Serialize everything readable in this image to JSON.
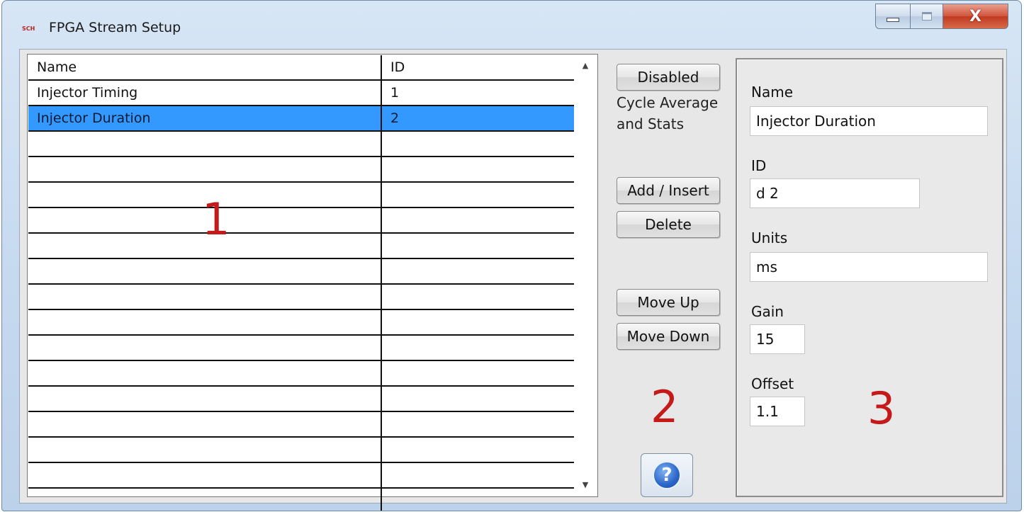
{
  "window": {
    "title": "FPGA Stream Setup",
    "icon_text": "SCH",
    "controls": {
      "close_glyph": "X"
    }
  },
  "table": {
    "columns": [
      "Name",
      "ID"
    ],
    "rows": [
      {
        "name": "Injector Timing",
        "id": "1"
      },
      {
        "name": "Injector Duration",
        "id": "2",
        "selected": true
      }
    ],
    "selected_color": "#3399ff"
  },
  "buttons": {
    "disabled": "Disabled",
    "cycle_label": "Cycle Average and Stats",
    "add_insert": "Add / Insert",
    "delete": "Delete",
    "move_up": "Move Up",
    "move_down": "Move Down",
    "help_glyph": "?"
  },
  "fields": {
    "name_label": "Name",
    "name_value": "Injector Duration",
    "id_label": "ID",
    "id_value": "d 2",
    "units_label": "Units",
    "units_value": "ms",
    "gain_label": "Gain",
    "gain_value": "15",
    "offset_label": "Offset",
    "offset_value": "1.1"
  },
  "annotations": {
    "a1": "1",
    "a2": "2",
    "a3": "3"
  },
  "icons": [
    "app-icon",
    "minimize-icon",
    "maximize-icon",
    "close-icon",
    "scroll-up-icon",
    "scroll-down-icon",
    "help-icon"
  ]
}
